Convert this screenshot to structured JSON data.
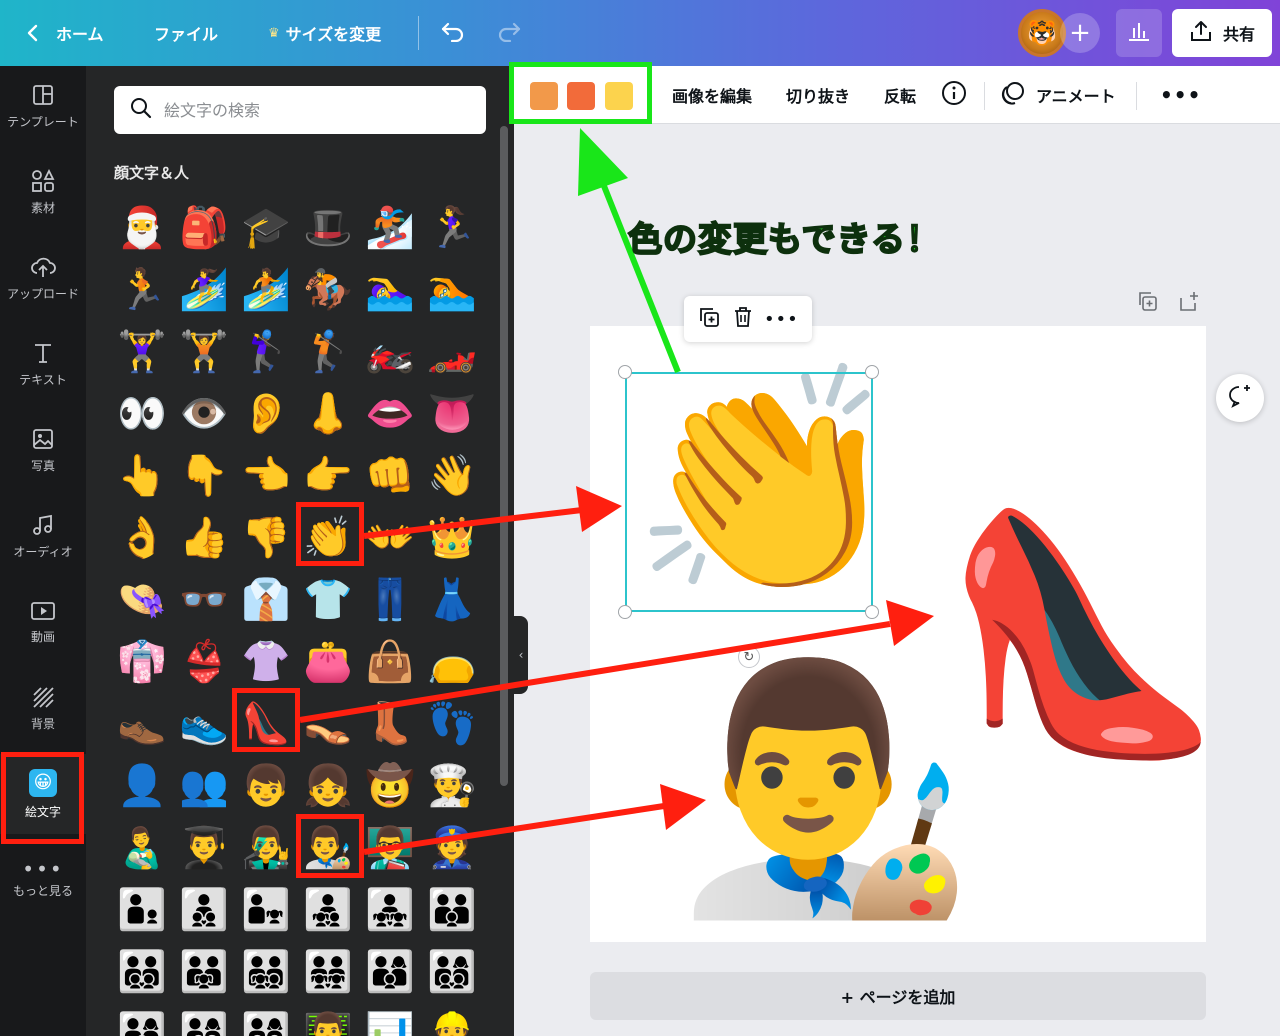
{
  "topbar": {
    "home": "ホーム",
    "file": "ファイル",
    "resize": "サイズを変更",
    "share": "共有"
  },
  "rail": [
    {
      "label": "テンプレート",
      "icon": "template-icon"
    },
    {
      "label": "素材",
      "icon": "elements-icon"
    },
    {
      "label": "アップロード",
      "icon": "upload-icon"
    },
    {
      "label": "テキスト",
      "icon": "text-icon"
    },
    {
      "label": "写真",
      "icon": "photo-icon"
    },
    {
      "label": "オーディオ",
      "icon": "audio-icon"
    },
    {
      "label": "動画",
      "icon": "video-icon"
    },
    {
      "label": "背景",
      "icon": "background-icon"
    },
    {
      "label": "絵文字",
      "icon": "emoji-app-icon"
    },
    {
      "label": "もっと見る",
      "icon": "more-icon"
    }
  ],
  "panel": {
    "search_placeholder": "絵文字の検索",
    "section_title": "顔文字＆人",
    "emojis": [
      [
        "🎅",
        "🎒",
        "🎓",
        "🎩",
        "🏂",
        "🏃‍♀️"
      ],
      [
        "🏃",
        "🏄‍♀️",
        "🏄",
        "🏇",
        "🏊‍♀️",
        "🏊"
      ],
      [
        "🏋️‍♀️",
        "🏋️",
        "🏌️‍♀️",
        "🏌️",
        "🏍️",
        "🏎️"
      ],
      [
        "👀",
        "👁️",
        "👂",
        "👃",
        "👄",
        "👅"
      ],
      [
        "👆",
        "👇",
        "👈",
        "👉",
        "👊",
        "👋"
      ],
      [
        "👌",
        "👍",
        "👎",
        "👏",
        "👐",
        "👑"
      ],
      [
        "👒",
        "👓",
        "👔",
        "👕",
        "👖",
        "👗"
      ],
      [
        "👘",
        "👙",
        "👚",
        "👛",
        "👜",
        "👝"
      ],
      [
        "👞",
        "👟",
        "👠",
        "👡",
        "👢",
        "👣"
      ],
      [
        "👤",
        "👥",
        "👦",
        "👧",
        "🤠",
        "👨‍🍳"
      ],
      [
        "👨‍🍼",
        "👨‍🎓",
        "👨‍🎤",
        "👨‍🎨",
        "👨‍🏫",
        "👮"
      ],
      [
        "👨‍👦",
        "👨‍👦‍👦",
        "👨‍👧",
        "👨‍👧‍👦",
        "👨‍👧‍👧",
        "👨‍👨‍👦"
      ],
      [
        "👨‍👨‍👦‍👦",
        "👨‍👨‍👧",
        "👨‍👨‍👧‍👦",
        "👨‍👨‍👧‍👧",
        "👨‍👩‍👦",
        "👨‍👩‍👦‍👦"
      ],
      [
        "👨‍👩‍👧",
        "👨‍👩‍👧‍👦",
        "👨‍👩‍👧‍👧",
        "👨‍💻",
        "📊",
        "👷"
      ]
    ]
  },
  "context_bar": {
    "swatches": [
      "#f2994a",
      "#f26b3a",
      "#fcd34d"
    ],
    "edit_image": "画像を編集",
    "crop": "切り抜き",
    "flip": "反転",
    "animate": "アニメート"
  },
  "canvas": {
    "clap_emoji": "👏",
    "heel_emoji": "👠",
    "artist_emoji": "👨‍🎨",
    "add_page": "+ ページを追加"
  },
  "annotation": {
    "callout": "色の変更もできる！",
    "red": "#ff1f0f",
    "green": "#19e619"
  }
}
